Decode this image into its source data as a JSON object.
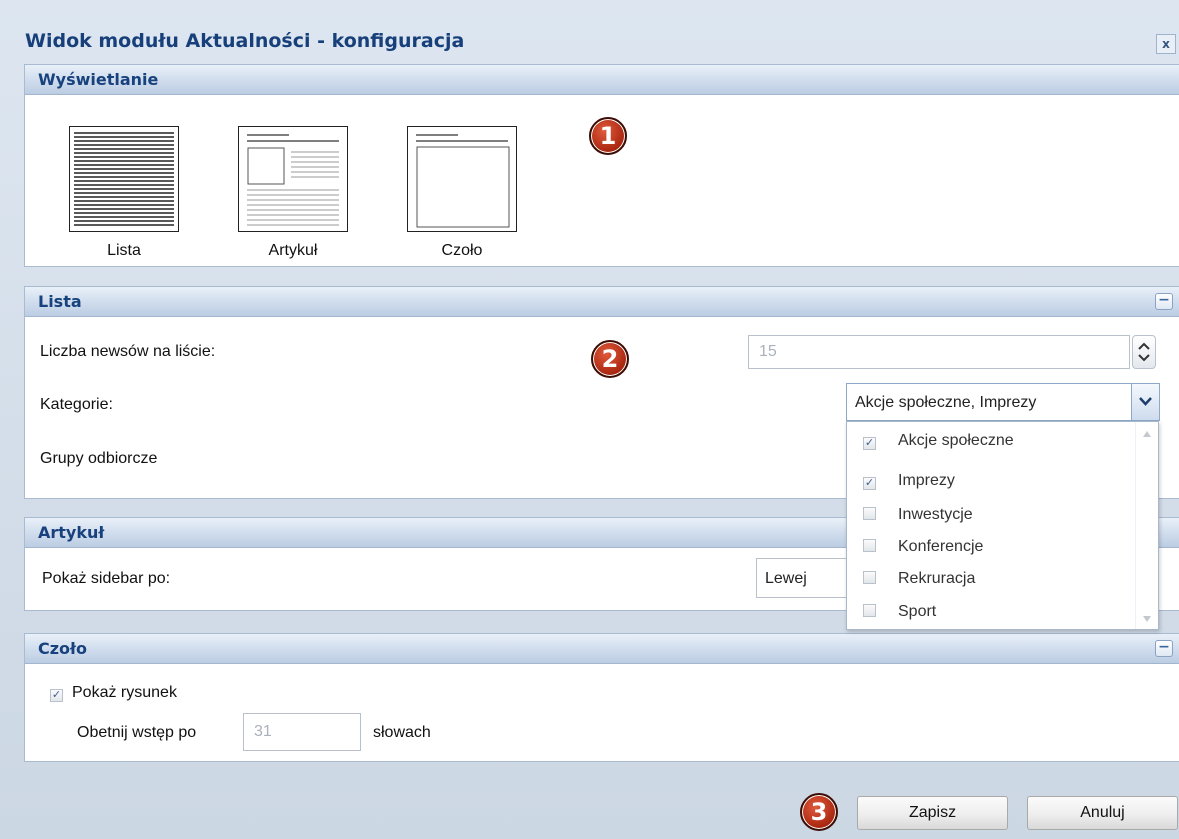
{
  "dialog": {
    "title": "Widok modułu Aktualności - konfiguracja",
    "close_label": "x"
  },
  "sections": {
    "display": {
      "heading": "Wyświetlanie",
      "marker": "1",
      "layouts": [
        "Lista",
        "Artykuł",
        "Czoło"
      ]
    },
    "list": {
      "heading": "Lista",
      "collapse_label": "−",
      "marker": "2",
      "news_count_label": "Liczba newsów na liście:",
      "news_count_value": "15",
      "categories_label": "Kategorie:",
      "categories_value": "Akcje społeczne, Imprezy",
      "groups_label": "Grupy odbiorcze",
      "category_options": [
        {
          "label": "Akcje społeczne",
          "checked": true
        },
        {
          "label": "Imprezy",
          "checked": true
        },
        {
          "label": "Inwestycje",
          "checked": false
        },
        {
          "label": "Konferencje",
          "checked": false
        },
        {
          "label": "Rekruracja",
          "checked": false
        },
        {
          "label": "Sport",
          "checked": false
        }
      ]
    },
    "article": {
      "heading": "Artykuł",
      "sidebar_label": "Pokaż sidebar po:",
      "sidebar_value": "Lewej"
    },
    "header": {
      "heading": "Czoło",
      "collapse_label": "−",
      "show_image_label": "Pokaż rysunek",
      "show_image_checked": true,
      "trim_prefix": "Obetnij wstęp po",
      "trim_value": "31",
      "trim_suffix": "słowach"
    }
  },
  "footer": {
    "marker": "3",
    "save_label": "Zapisz",
    "cancel_label": "Anuluj"
  }
}
